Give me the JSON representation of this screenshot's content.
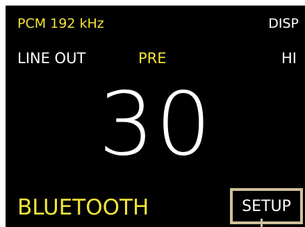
{
  "status": {
    "format": "PCM 192 kHz",
    "disp_label": "DISP"
  },
  "settings": {
    "output": "LINE OUT",
    "mode": "PRE",
    "gain": "HI"
  },
  "volume": {
    "value": "30"
  },
  "footer": {
    "source": "BLUETOOTH",
    "setup_label": "SETUP"
  },
  "colors": {
    "accent": "#f2e43a",
    "text": "#ffffff",
    "background": "#000000",
    "highlight_border": "#cfc09a"
  }
}
